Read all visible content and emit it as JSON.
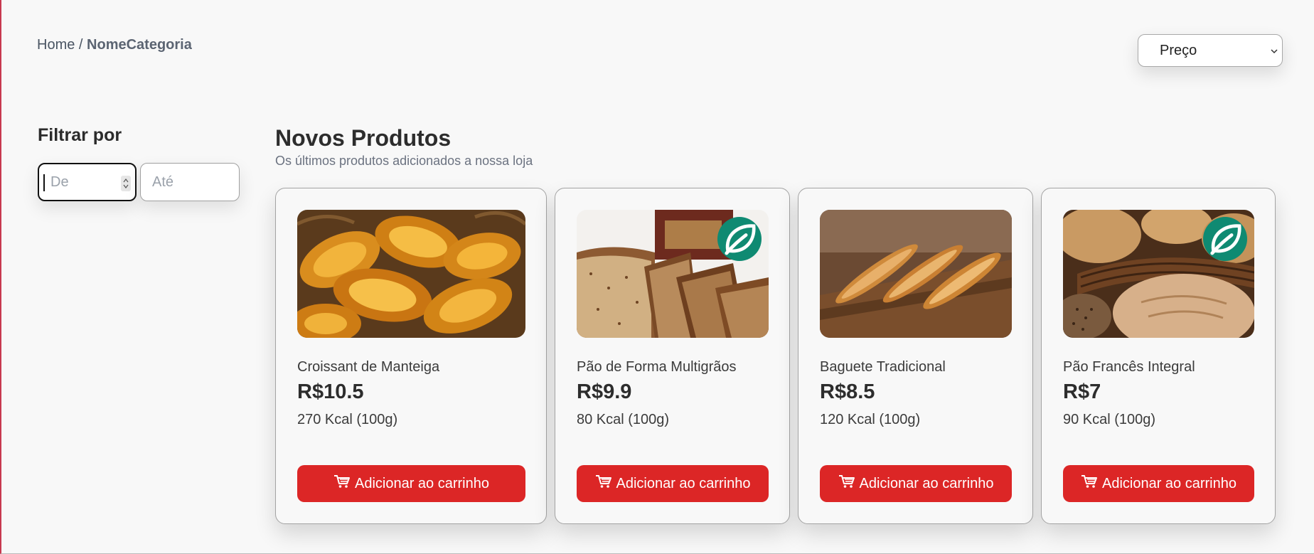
{
  "breadcrumb": {
    "home": "Home",
    "separator": " / ",
    "category": "NomeCategoria"
  },
  "sort": {
    "selected": "Preço"
  },
  "filter": {
    "title": "Filtrar por",
    "from_placeholder": "De",
    "to_placeholder": "Até"
  },
  "section": {
    "title": "Novos Produtos",
    "subtitle": "Os últimos produtos adicionados a nossa loja"
  },
  "products": [
    {
      "name": "Croissant de Manteiga",
      "price": "R$10.5",
      "kcal": "270 Kcal (100g)",
      "button": "Adicionar ao carrinho",
      "eco": false,
      "image": "croissants-in-basket"
    },
    {
      "name": "Pão de Forma Multigrãos",
      "price": "R$9.9",
      "kcal": "80 Kcal (100g)",
      "button": "Adicionar ao carrinho",
      "eco": true,
      "image": "sliced-multigrain-bread"
    },
    {
      "name": "Baguete Tradicional",
      "price": "R$8.5",
      "kcal": "120 Kcal (100g)",
      "button": "Adicionar ao carrinho",
      "eco": false,
      "image": "baguettes-on-board"
    },
    {
      "name": "Pão Francês Integral",
      "price": "R$7",
      "kcal": "90 Kcal (100g)",
      "button": "Adicionar ao carrinho",
      "eco": true,
      "image": "whole-grain-rolls-in-basket"
    }
  ],
  "icons": {
    "cart": "cart-icon",
    "leaf": "leaf-icon",
    "chevron": "chevron-down-icon"
  },
  "colors": {
    "accent": "#dc2626",
    "eco_badge": "#0f8a72"
  }
}
